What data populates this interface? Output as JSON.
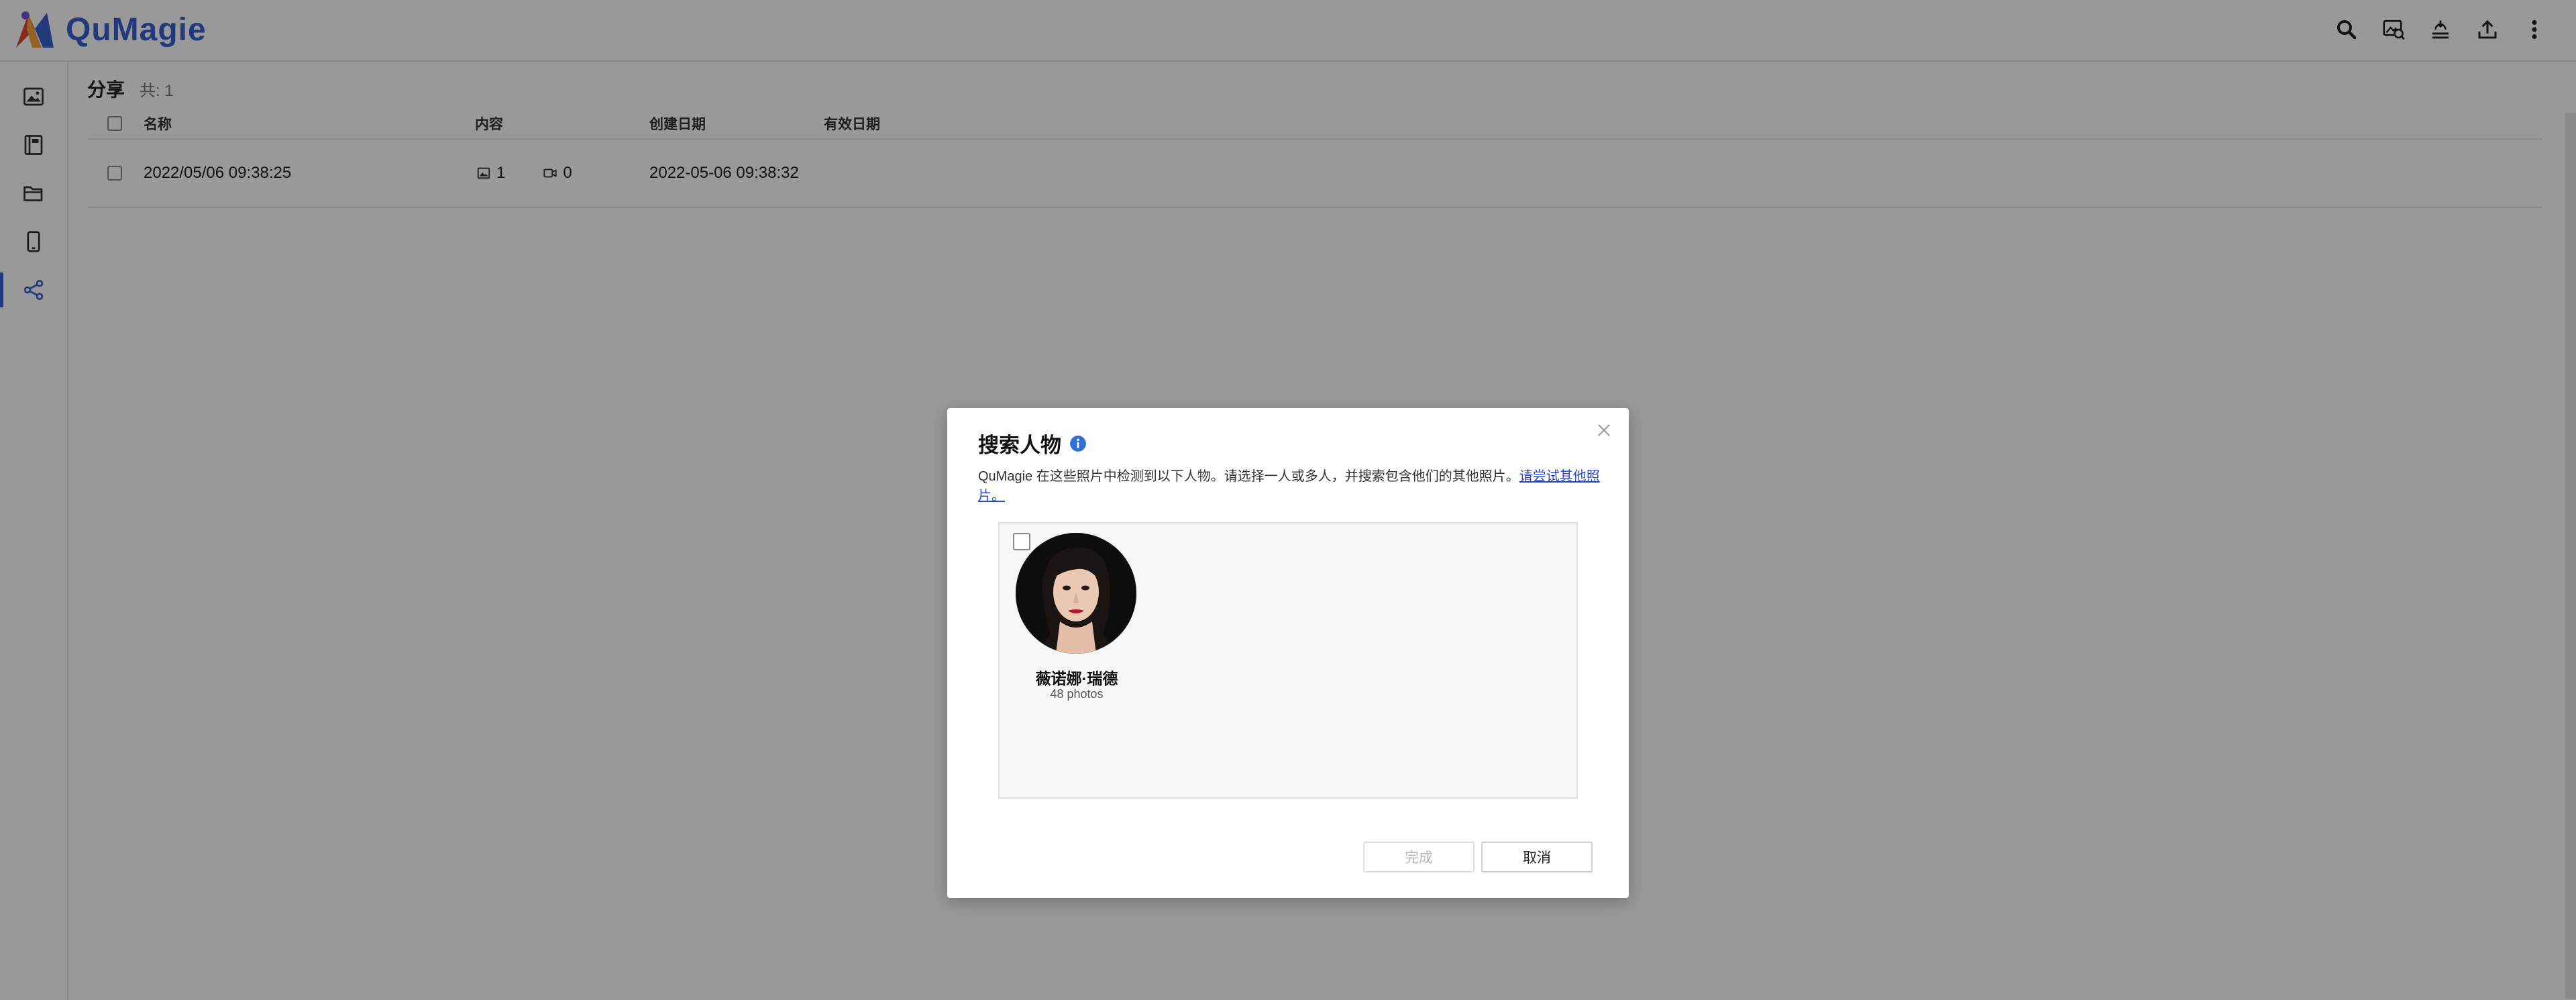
{
  "app": {
    "name": "QuMagie",
    "brand_color": "#3b5fd0"
  },
  "topbar": {
    "actions": [
      {
        "name": "search-icon"
      },
      {
        "name": "photo-search-icon"
      },
      {
        "name": "background-task-icon"
      },
      {
        "name": "upload-icon"
      },
      {
        "name": "more-vertical-icon"
      }
    ]
  },
  "sidebar": {
    "items": [
      {
        "icon": "photos-icon",
        "active": false
      },
      {
        "icon": "albums-icon",
        "active": false
      },
      {
        "icon": "folders-icon",
        "active": false
      },
      {
        "icon": "mobile-icon",
        "active": false
      },
      {
        "icon": "share-icon",
        "active": true
      }
    ]
  },
  "page": {
    "title": "分享",
    "count_label": "共: 1"
  },
  "table": {
    "columns": [
      "名称",
      "内容",
      "创建日期",
      "有效日期"
    ],
    "rows": [
      {
        "name": "2022/05/06 09:38:25",
        "photo_count": "1",
        "video_count": "0",
        "created": "2022-05-06 09:38:32",
        "expires": ""
      }
    ]
  },
  "dialog": {
    "title": "搜索人物",
    "description": "QuMagie 在这些照片中检测到以下人物。请选择一人或多人，并搜索包含他们的其他照片。",
    "link_text": "请尝试其他照片。",
    "people": [
      {
        "name": "薇诺娜·瑞德",
        "count": "48 photos",
        "checked": false
      }
    ],
    "buttons": {
      "done": "完成",
      "cancel": "取消"
    }
  }
}
